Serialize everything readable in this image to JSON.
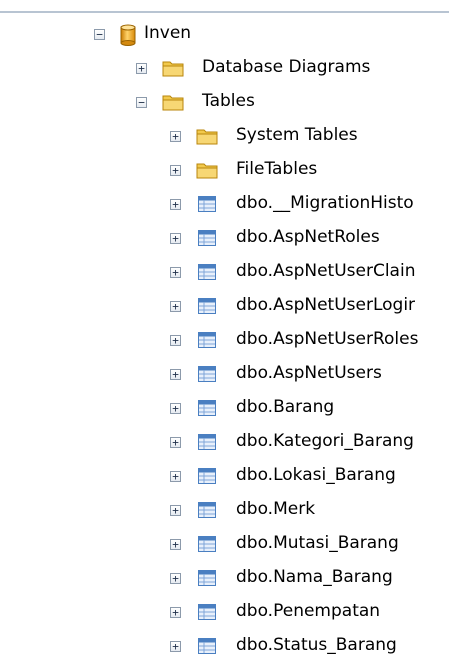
{
  "tree": {
    "root": {
      "label": "Inven",
      "icon": "database-icon",
      "expanded": true
    },
    "database_diagrams": {
      "label": "Database Diagrams",
      "icon": "folder-icon",
      "expanded": false
    },
    "tables": {
      "label": "Tables",
      "icon": "folder-icon",
      "expanded": true
    },
    "items": [
      {
        "label": "System Tables",
        "icon": "folder-icon",
        "expanded": false
      },
      {
        "label": "FileTables",
        "icon": "folder-icon",
        "expanded": false
      },
      {
        "label": "dbo.__MigrationHisto",
        "icon": "table-icon",
        "expanded": false
      },
      {
        "label": "dbo.AspNetRoles",
        "icon": "table-icon",
        "expanded": false
      },
      {
        "label": "dbo.AspNetUserClain",
        "icon": "table-icon",
        "expanded": false
      },
      {
        "label": "dbo.AspNetUserLogir",
        "icon": "table-icon",
        "expanded": false
      },
      {
        "label": "dbo.AspNetUserRoles",
        "icon": "table-icon",
        "expanded": false
      },
      {
        "label": "dbo.AspNetUsers",
        "icon": "table-icon",
        "expanded": false
      },
      {
        "label": "dbo.Barang",
        "icon": "table-icon",
        "expanded": false
      },
      {
        "label": "dbo.Kategori_Barang",
        "icon": "table-icon",
        "expanded": false
      },
      {
        "label": "dbo.Lokasi_Barang",
        "icon": "table-icon",
        "expanded": false
      },
      {
        "label": "dbo.Merk",
        "icon": "table-icon",
        "expanded": false
      },
      {
        "label": "dbo.Mutasi_Barang",
        "icon": "table-icon",
        "expanded": false
      },
      {
        "label": "dbo.Nama_Barang",
        "icon": "table-icon",
        "expanded": false
      },
      {
        "label": "dbo.Penempatan",
        "icon": "table-icon",
        "expanded": false
      },
      {
        "label": "dbo.Status_Barang",
        "icon": "table-icon",
        "expanded": false
      }
    ],
    "glyphs": {
      "expand": "+",
      "collapse": "−"
    }
  },
  "colors": {
    "folder": "#e8b93a",
    "database": "#e9a21f",
    "table": "#4a7fc1"
  }
}
